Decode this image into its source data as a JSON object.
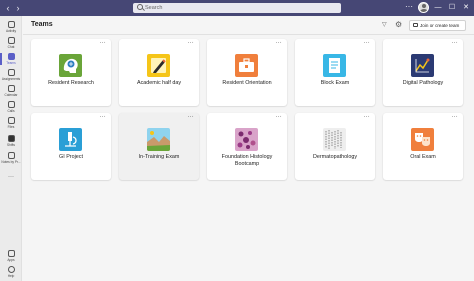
{
  "titlebar": {
    "search_placeholder": "Search",
    "more_label": "···",
    "window_controls": [
      "—",
      "☐",
      "✕"
    ],
    "back_icon": "chevron-left-icon",
    "forward_icon": "chevron-right-icon"
  },
  "rail": {
    "items": [
      {
        "label": "Activity",
        "icon": "bell-icon"
      },
      {
        "label": "Chat",
        "icon": "chat-icon"
      },
      {
        "label": "Teams",
        "icon": "teams-icon",
        "active": true
      },
      {
        "label": "Assignments",
        "icon": "assignments-icon"
      },
      {
        "label": "Calendar",
        "icon": "calendar-icon"
      },
      {
        "label": "Calls",
        "icon": "phone-icon"
      },
      {
        "label": "Files",
        "icon": "file-icon"
      },
      {
        "label": "Shifts",
        "icon": "shifts-icon"
      },
      {
        "label": "Notes by Pr...",
        "icon": "notes-icon"
      },
      {
        "label": "···",
        "icon": "more-icon"
      }
    ],
    "bottom": [
      {
        "label": "Apps",
        "icon": "apps-icon"
      },
      {
        "label": "Help",
        "icon": "help-icon"
      }
    ]
  },
  "header": {
    "title": "Teams",
    "join_button": "Join or create team"
  },
  "teams": [
    {
      "name": "Resident Research",
      "more": "···",
      "logo_color": "#6aa539"
    },
    {
      "name": "Academic half day",
      "more": "···",
      "logo_color": "#f5c518"
    },
    {
      "name": "Resident Orientation",
      "more": "···",
      "logo_color": "#f07f3c"
    },
    {
      "name": "Block Exam",
      "more": "···",
      "logo_color": "#38b7e6"
    },
    {
      "name": "Digital Pathology",
      "more": "···",
      "logo_color": "#2b3a73"
    },
    {
      "name": "GI Project",
      "more": "···",
      "logo_color": "#2a9fd6"
    },
    {
      "name": "In-Training Exam",
      "more": "···",
      "logo_color": "#c99a6b"
    },
    {
      "name": "Foundation Histology Bootcamp",
      "more": "···",
      "logo_color": "#b0508c"
    },
    {
      "name": "Dermatopathology",
      "more": "···",
      "logo_color": "#9a9a9a"
    },
    {
      "name": "Oral Exam",
      "more": "···",
      "logo_color": "#f07f3c"
    }
  ]
}
